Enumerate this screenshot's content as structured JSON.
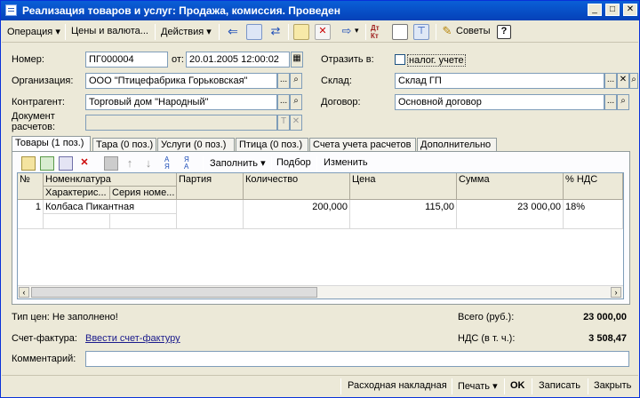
{
  "window": {
    "title": "Реализация товаров и услуг: Продажа, комиссия. Проведен"
  },
  "toolbar": {
    "operation": "Операция",
    "prices": "Цены и валюта...",
    "actions": "Действия",
    "tips": "Советы",
    "help": "?"
  },
  "form": {
    "number_label": "Номер:",
    "number_value": "ПГ000004",
    "date_label": "от:",
    "date_value": "20.01.2005 12:00:02",
    "reflect_label": "Отразить в:",
    "tax_label": "налог. учете",
    "org_label": "Организация:",
    "org_value": "ООО \"Птицефабрика Горьковская\"",
    "warehouse_label": "Склад:",
    "warehouse_value": "Склад ГП",
    "counterparty_label": "Контрагент:",
    "counterparty_value": "Торговый дом \"Народный\"",
    "contract_label": "Договор:",
    "contract_value": "Основной договор",
    "settlement_label_1": "Документ",
    "settlement_label_2": "расчетов:"
  },
  "tabs": [
    "Товары (1 поз.)",
    "Тара (0 поз.)",
    "Услуги (0 поз.)",
    "Птица (0 поз.)",
    "Счета учета расчетов",
    "Дополнительно"
  ],
  "table_toolbar": {
    "fill": "Заполнить",
    "selection": "Подбор",
    "change": "Изменить"
  },
  "table": {
    "headers": {
      "num": "№",
      "nomenclature": "Номенклатура",
      "characteristic": "Характерис...",
      "series": "Серия номе...",
      "batch": "Партия",
      "quantity": "Количество",
      "price": "Цена",
      "sum": "Сумма",
      "vat": "% НДС"
    },
    "rows": [
      {
        "num": "1",
        "nomenclature": "Колбаса Пикантная",
        "quantity": "200,000",
        "price": "115,00",
        "sum": "23 000,00",
        "vat": "18%"
      }
    ]
  },
  "footer": {
    "price_type": "Тип цен: Не заполнено!",
    "total_label": "Всего (руб.):",
    "total_value": "23 000,00",
    "invoice_label": "Счет-фактура:",
    "invoice_link": "Ввести счет-фактуру",
    "vat_label": "НДС (в т. ч.):",
    "vat_value": "3 508,47",
    "comment_label": "Комментарий:"
  },
  "bottom": {
    "invoice_doc": "Расходная накладная",
    "print": "Печать",
    "ok": "OK",
    "save": "Записать",
    "close": "Закрыть"
  },
  "colors": {
    "titlebar": "#0a5fd7",
    "window_bg": "#ece9d8",
    "link": "#1a1a8c"
  }
}
